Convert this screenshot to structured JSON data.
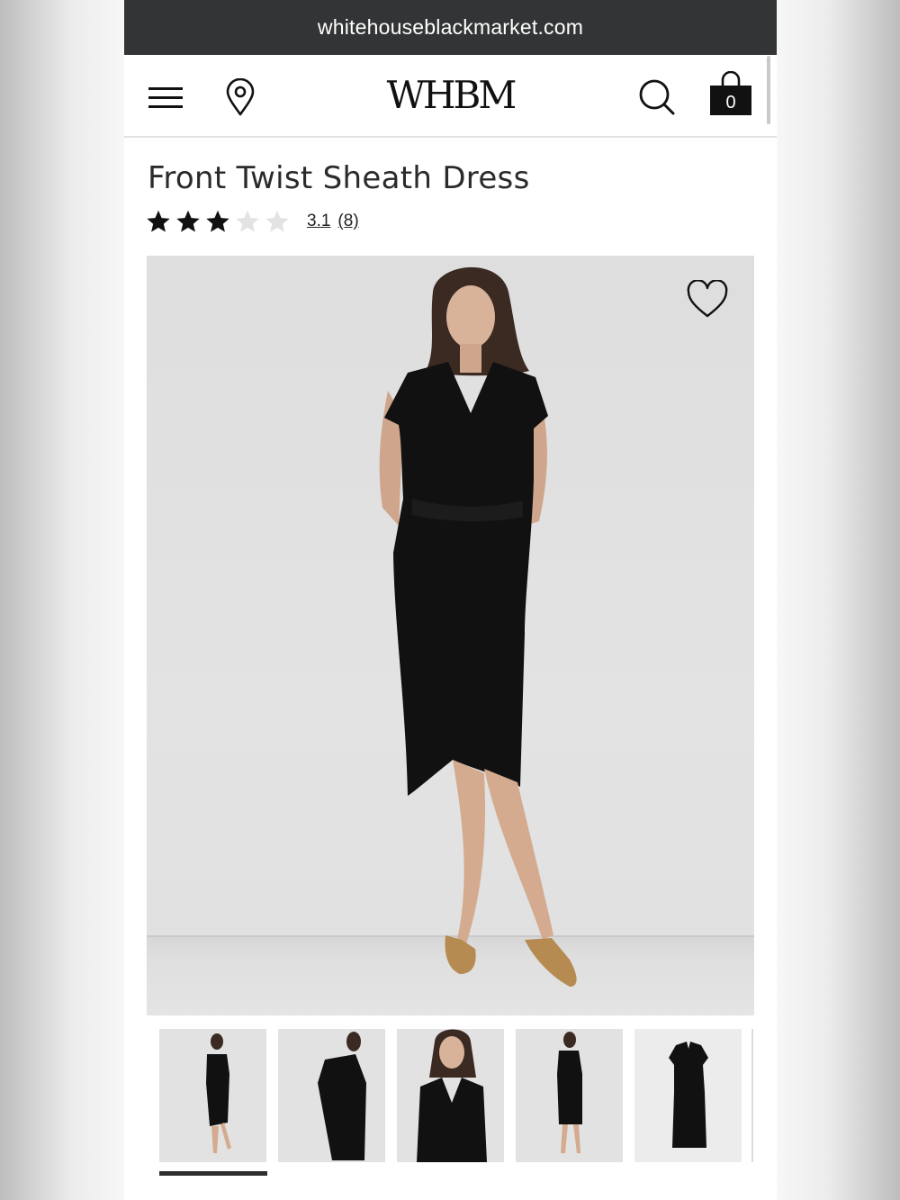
{
  "browser": {
    "url": "whitehouseblackmarket.com"
  },
  "header": {
    "logo": "WHBM",
    "menu_icon": "hamburger-menu-icon",
    "location_icon": "map-pin-icon",
    "search_icon": "search-icon",
    "bag_icon": "shopping-bag-icon",
    "bag_count": "0"
  },
  "product": {
    "title": "Front Twist Sheath Dress",
    "rating": {
      "value": "3.1",
      "count": "(8)",
      "stars_filled": 3,
      "stars_total": 5
    },
    "favorite_icon": "heart-icon",
    "thumbnails": [
      {
        "label": "front-full",
        "active": true
      },
      {
        "label": "side-jacket"
      },
      {
        "label": "front-closeup"
      },
      {
        "label": "back-full"
      },
      {
        "label": "flat-lay"
      }
    ]
  },
  "colors": {
    "urlbar_bg": "#333435",
    "text": "#2b2b2b",
    "photo_bg": "#e0e0e0",
    "dress": "#111111"
  }
}
